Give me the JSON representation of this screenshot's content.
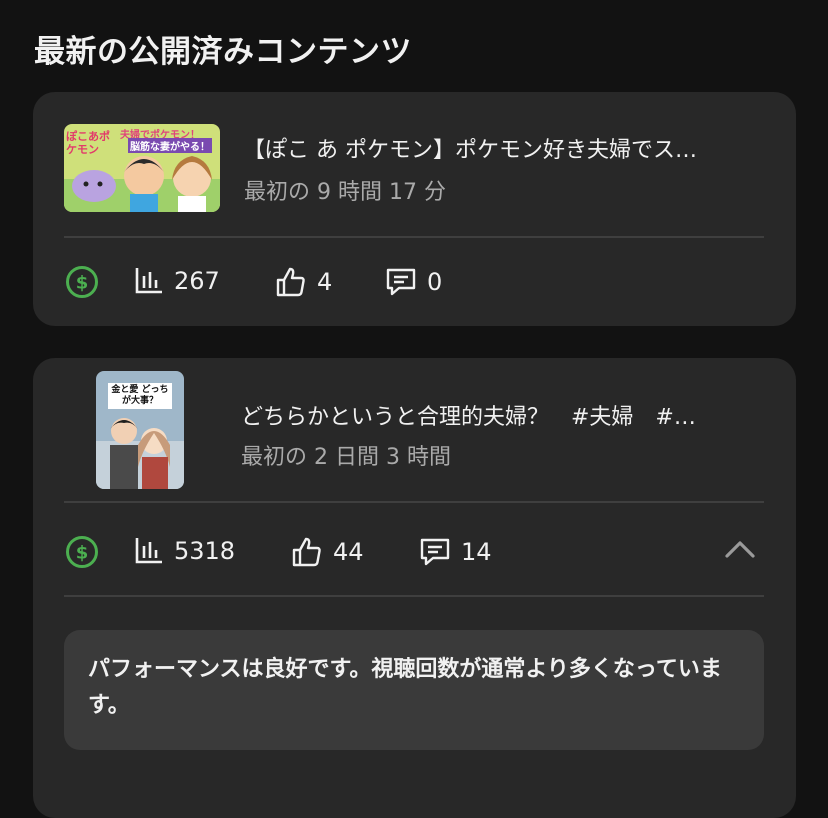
{
  "section_title": "最新の公開済みコンテンツ",
  "videos": [
    {
      "title": "【ぽこ あ ポケモン】ポケモン好き夫婦でス…",
      "subtitle": "最初の 9 時間 17 分",
      "thumb_caption_top": "夫婦でポケモン！",
      "thumb_caption_mid": "脳筋な妻がやる！",
      "thumb_logo": "ぽこあポケモン",
      "views": "267",
      "likes": "4",
      "comments": "0",
      "revenue_icon": "dollar-circle-icon"
    },
    {
      "title": "どちらかというと合理的夫婦？　#夫婦　#…",
      "subtitle": "最初の 2 日間 3 時間",
      "thumb_caption": "金と愛 どっちが大事？",
      "views": "5318",
      "likes": "44",
      "comments": "14",
      "revenue_icon": "dollar-circle-icon",
      "performance_note": "パフォーマンスは良好です。視聴回数が通常より多くなっています。"
    }
  ],
  "colors": {
    "background": "#121212",
    "card": "#282828",
    "revenue_green": "#4caf50",
    "subtle_text": "#aaaaaa"
  }
}
